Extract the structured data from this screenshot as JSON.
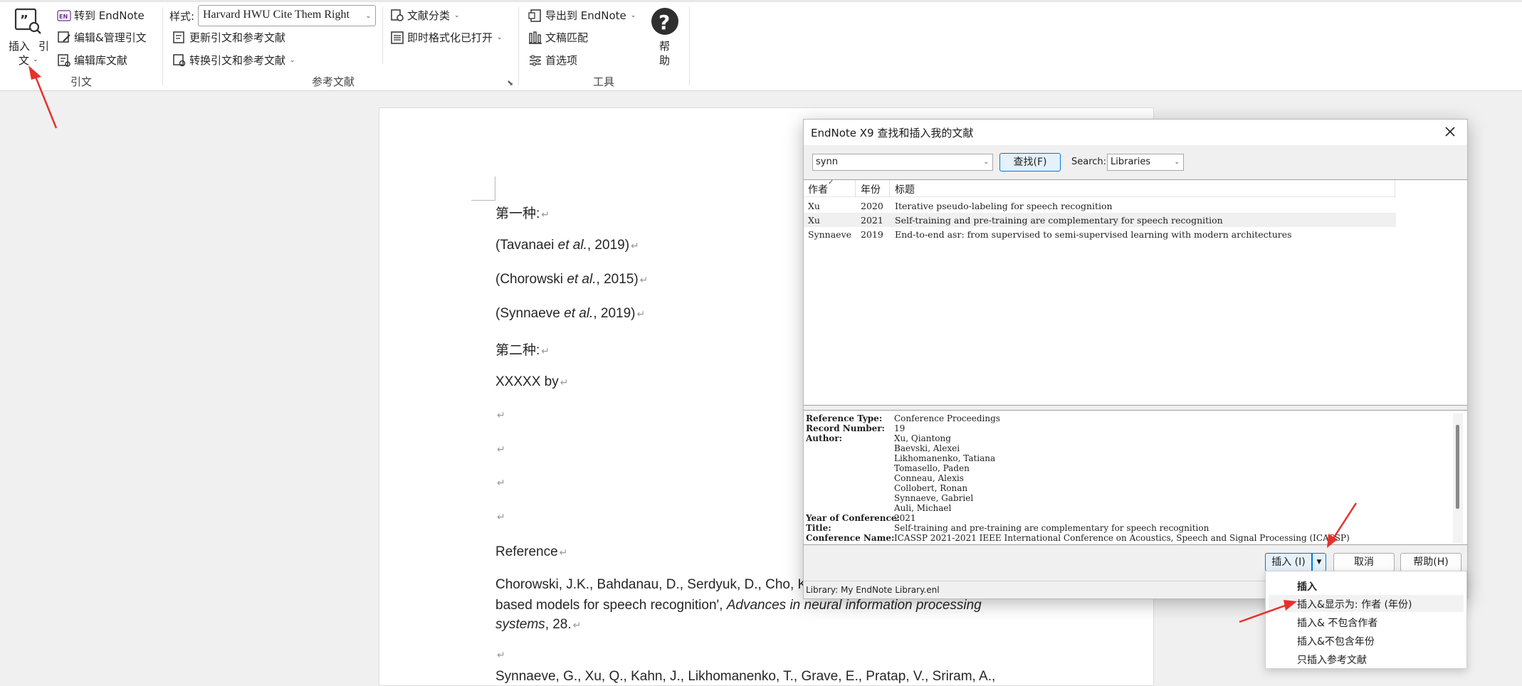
{
  "ribbon": {
    "citations_group": {
      "insert_citation_line1": "插入",
      "insert_citation_line1b": "引",
      "insert_citation_line2": "文",
      "go_to_endnote": "转到 EndNote",
      "edit_manage": "编辑&管理引文",
      "edit_library": "编辑库文献",
      "label": "引文"
    },
    "bibliography_group": {
      "style_label": "样式:",
      "style_value": "Harvard HWU Cite Them Right",
      "update": "更新引文和参考文献",
      "convert": "转换引文和参考文献",
      "categorize": "文献分类",
      "instant_format": "即时格式化已打开",
      "label": "参考文献"
    },
    "tools_group": {
      "export": "导出到 EndNote",
      "manuscript_matcher": "文稿匹配",
      "preferences": "首选项",
      "label": "工具"
    },
    "help": {
      "line1": "帮",
      "line2": "助"
    }
  },
  "document": {
    "lines": [
      {
        "text": "第一种:"
      },
      {
        "pre": "(Tavanaei ",
        "it": "et al.",
        "post": ", 2019)"
      },
      {
        "pre": "(Chorowski ",
        "it": "et al.",
        "post": ", 2015)"
      },
      {
        "pre": "(Synnaeve ",
        "it": "et al.",
        "post": ", 2019)"
      },
      {
        "text": "第二种:"
      },
      {
        "text": "XXXXX by"
      },
      {
        "text": ""
      },
      {
        "text": ""
      },
      {
        "text": ""
      },
      {
        "text": ""
      },
      {
        "text": "Reference"
      },
      {
        "text": "Chorowski, J.K., Bahdanau, D., Serdyuk, D., Cho, K."
      },
      {
        "pre": "based models for speech recognition', ",
        "it": "Advances in neural information processing",
        "post": ""
      },
      {
        "pre": "",
        "it": "systems",
        "post": ", 28."
      },
      {
        "text": ""
      },
      {
        "text": "Synnaeve, G., Xu, Q., Kahn, J., Likhomanenko, T., Grave, E., Pratap, V., Sriram, A.,"
      }
    ]
  },
  "dialog": {
    "title": "EndNote X9 查找和插入我的文献",
    "search_value": "synn",
    "find_button": "查找(F)",
    "search_label": "Search:",
    "search_scope": "Libraries",
    "columns": {
      "author": "作者",
      "year": "年份",
      "title": "标题"
    },
    "results": [
      {
        "author": "Xu",
        "year": "2020",
        "title": "Iterative pseudo-labeling for speech recognition"
      },
      {
        "author": "Xu",
        "year": "2021",
        "title": "Self-training and pre-training are complementary for speech recognition"
      },
      {
        "author": "Synnaeve",
        "year": "2019",
        "title": "End-to-end asr: from supervised to semi-supervised learning with modern architectures"
      }
    ],
    "detail": {
      "reference_type_k": "Reference Type:",
      "reference_type_v": "Conference Proceedings",
      "record_number_k": "Record Number:",
      "record_number_v": "19",
      "author_k": "Author:",
      "authors": [
        "Xu, Qiantong",
        "Baevski, Alexei",
        "Likhomanenko, Tatiana",
        "Tomasello, Paden",
        "Conneau, Alexis",
        "Collobert, Ronan",
        "Synnaeve, Gabriel",
        "Auli, Michael"
      ],
      "year_k": "Year of Conference:",
      "year_v": "2021",
      "title_k": "Title:",
      "title_v": "Self-training and pre-training are complementary for speech recognition",
      "conf_k": "Conference Name:",
      "conf_v": "ICASSP 2021-2021 IEEE International Conference on Acoustics, Speech and Signal Processing (ICASSP)"
    },
    "insert_button": "插入 (I)",
    "cancel_button": "取消",
    "help_button": "帮助(H)",
    "status": "Library: My EndNote Library.enl"
  },
  "insert_menu": [
    "插入",
    "插入&显示为: 作者 (年份)",
    "插入& 不包含作者",
    "插入&不包含年份",
    "只插入参考文献"
  ],
  "colors": {
    "accent": "#0078d7",
    "arrow": "#e5322d"
  }
}
